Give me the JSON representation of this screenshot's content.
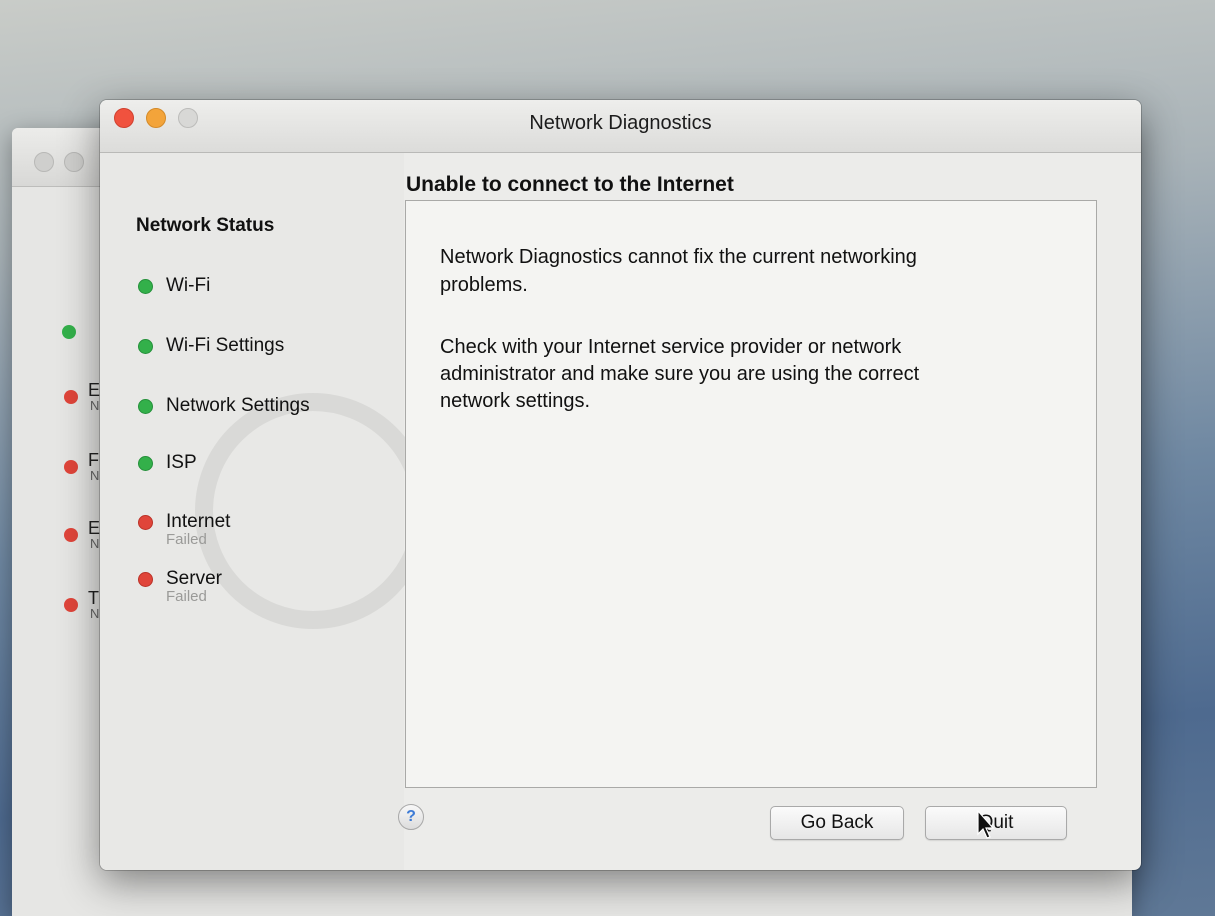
{
  "window": {
    "title": "Network Diagnostics"
  },
  "sidebar": {
    "title": "Network Status",
    "items": [
      {
        "label": "Wi-Fi",
        "status": "ok",
        "detail": ""
      },
      {
        "label": "Wi-Fi Settings",
        "status": "ok",
        "detail": ""
      },
      {
        "label": "Network Settings",
        "status": "ok",
        "detail": ""
      },
      {
        "label": "ISP",
        "status": "ok",
        "detail": ""
      },
      {
        "label": "Internet",
        "status": "failed",
        "detail": "Failed"
      },
      {
        "label": "Server",
        "status": "failed",
        "detail": "Failed"
      }
    ]
  },
  "content": {
    "title": "Unable to connect to the Internet",
    "paragraph1_line1": "Network Diagnostics cannot fix the current networking",
    "paragraph1_line2": "problems.",
    "paragraph2_line1": "Check with your Internet service provider or network",
    "paragraph2_line2": "administrator and make sure you are using the correct",
    "paragraph2_line3": "network settings."
  },
  "buttons": {
    "help": "?",
    "go_back": "Go Back",
    "quit": "Quit"
  },
  "background_window": {
    "rows": [
      {
        "letter": "E",
        "sub": "N"
      },
      {
        "letter": "F",
        "sub": "N"
      },
      {
        "letter": "E",
        "sub": "N"
      },
      {
        "letter": "T",
        "sub": "N"
      }
    ]
  },
  "colors": {
    "ok": "#33b04a",
    "failed": "#e0453a",
    "close": "#f0523e",
    "minimize": "#f3a43a"
  }
}
